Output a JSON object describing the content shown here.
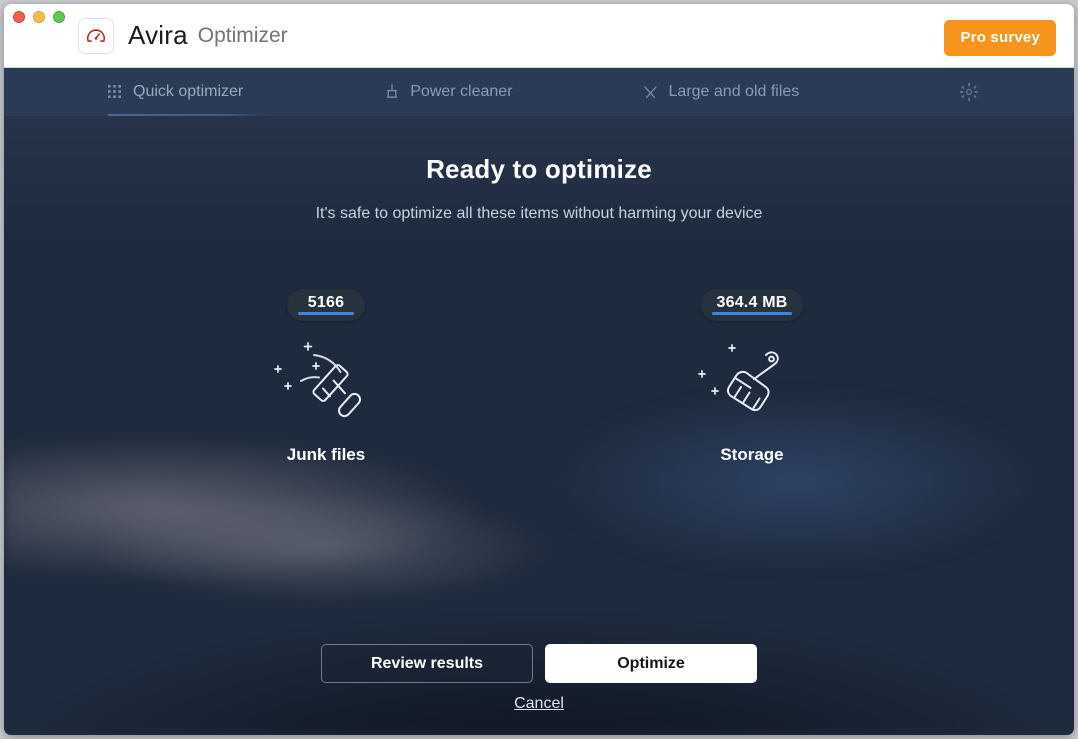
{
  "window": {
    "traffic_lights": [
      {
        "name": "close",
        "color": "#ee5f56"
      },
      {
        "name": "minimize",
        "color": "#f5bd4f"
      },
      {
        "name": "zoom",
        "color": "#61c454"
      }
    ]
  },
  "header": {
    "logo_icon": "speedometer-icon",
    "brand": "Avira",
    "product": "Optimizer",
    "pro_survey_label": "Pro survey",
    "pro_survey_color": "#f7941d"
  },
  "tabs": [
    {
      "id": "quick-optimizer",
      "label": "Quick optimizer",
      "icon": "grid-icon",
      "active": true
    },
    {
      "id": "power-cleaner",
      "label": "Power cleaner",
      "icon": "broom-icon",
      "active": false
    },
    {
      "id": "large-and-old-files",
      "label": "Large and old files",
      "icon": "scissors-icon",
      "active": false
    }
  ],
  "settings": {
    "icon": "gear-icon"
  },
  "main": {
    "headline": "Ready to optimize",
    "subhead": "It's safe to optimize all these items without harming your device",
    "cards": [
      {
        "id": "junk-files",
        "badge_value": "5166",
        "label": "Junk files",
        "icon": "squeegee-icon",
        "bar_color": "#3d86e0"
      },
      {
        "id": "storage",
        "badge_value": "364.4 MB",
        "label": "Storage",
        "icon": "brush-icon",
        "bar_color": "#3d86e0"
      }
    ]
  },
  "footer": {
    "review_results_label": "Review results",
    "optimize_label": "Optimize",
    "cancel_label": "Cancel"
  }
}
